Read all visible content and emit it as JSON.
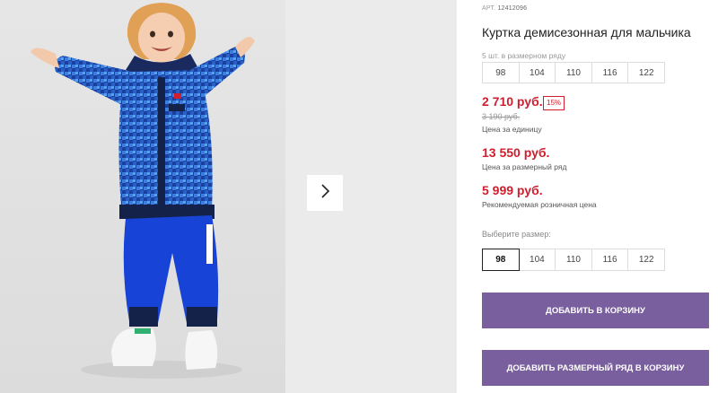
{
  "product": {
    "art_label": "АРТ.",
    "art_number": "12412096",
    "title": "Куртка демисезонная для мальчика",
    "size_row_note": "5 шт. в размерном ряду",
    "size_row_sizes": [
      "98",
      "104",
      "110",
      "116",
      "122"
    ],
    "unit_price": "2 710 руб.",
    "discount": "15%",
    "old_price": "3 190 руб.",
    "unit_price_caption": "Цена за единицу",
    "row_price": "13 550 руб.",
    "row_price_caption": "Цена за размерный ряд",
    "retail_price": "5 999 руб.",
    "retail_price_caption": "Рекомендуемая розничная цена",
    "choose_size_label": "Выберите размер:",
    "selectable_sizes": [
      "98",
      "104",
      "110",
      "116",
      "122"
    ],
    "selected_size": "98"
  },
  "buttons": {
    "add_to_cart": "ДОБАВИТЬ В КОРЗИНУ",
    "add_row_to_cart": "ДОБАВИТЬ РАЗМЕРНЫЙ РЯД В КОРЗИНУ"
  },
  "gallery": {
    "jacket_logo": "PLAY&GO",
    "next_icon": "chevron-right-icon"
  },
  "colors": {
    "accent_button": "#7a5f9e",
    "price_red": "#d01e2f",
    "jacket_blue": "#1f4fb5",
    "pants_blue": "#1744d6"
  }
}
